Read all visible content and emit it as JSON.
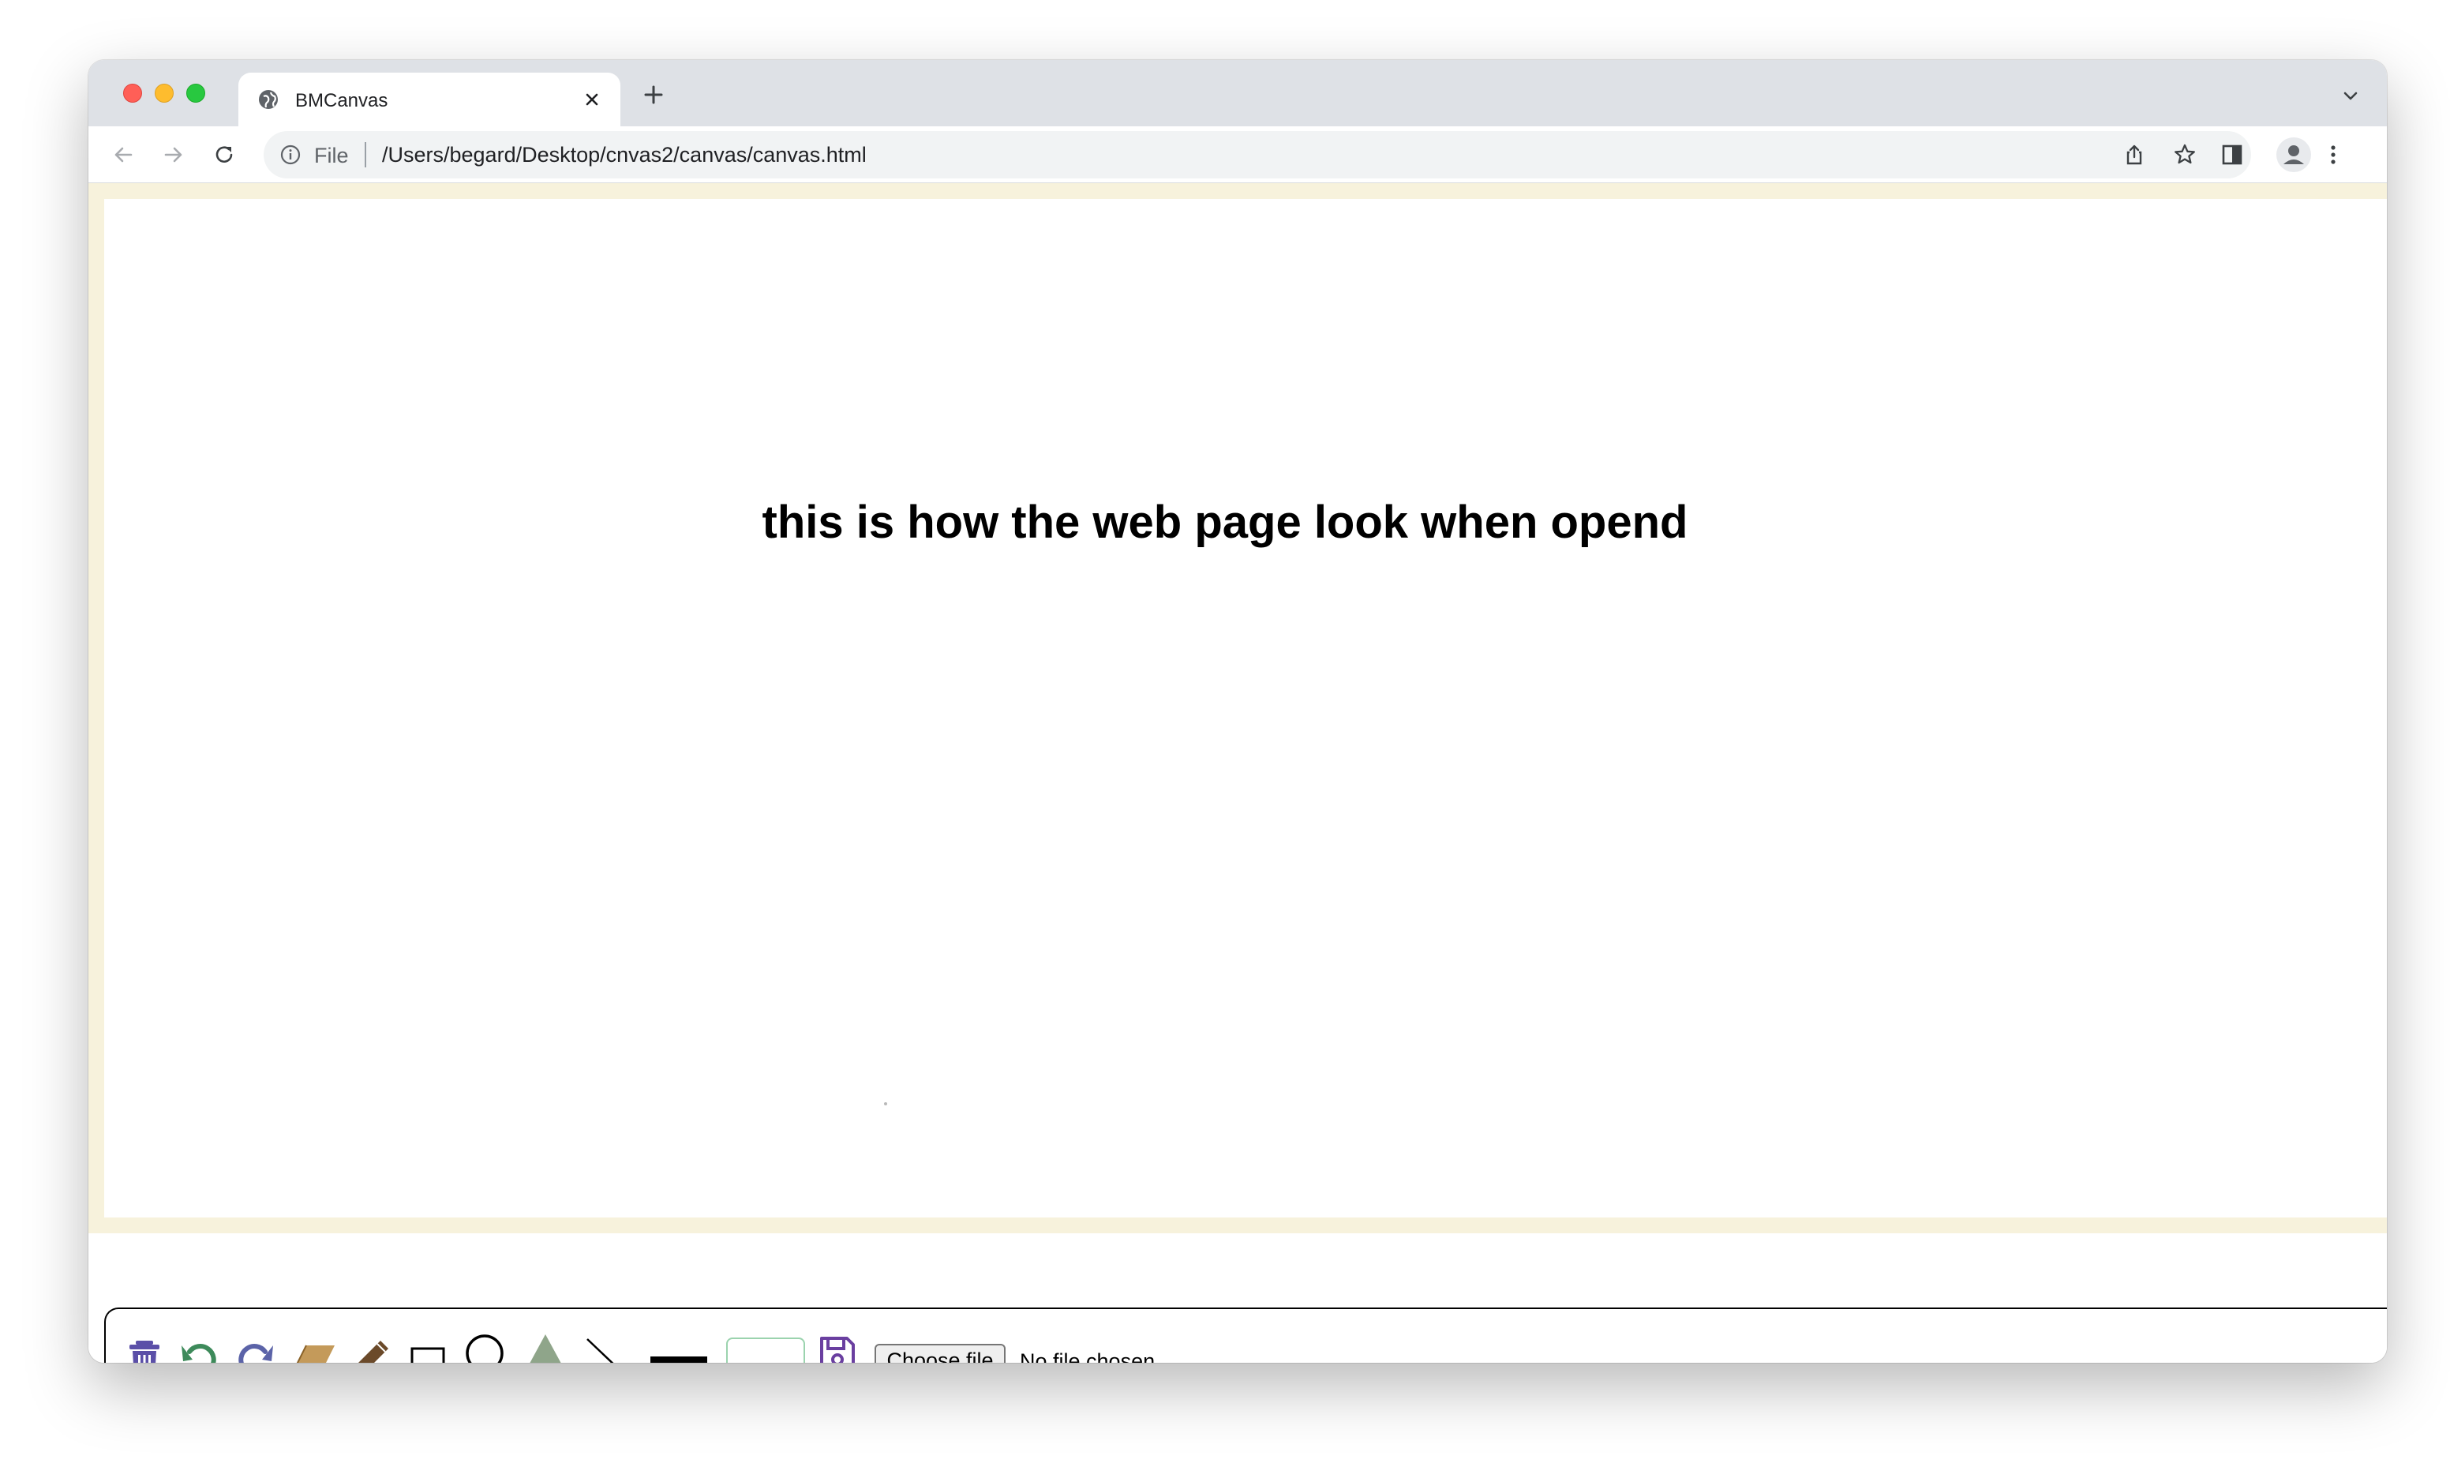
{
  "browser": {
    "tab_title": "BMCanvas",
    "url_scheme_label": "File",
    "url_path": "/Users/begard/Desktop/cnvas2/canvas/canvas.html"
  },
  "page": {
    "headline": "this is how the web page look when opend",
    "file_input": {
      "button_label": "Choose file",
      "status": "No file chosen"
    },
    "tools": [
      "trash-icon",
      "undo-icon",
      "redo-icon",
      "eraser-icon",
      "pencil-icon",
      "rectangle-icon",
      "circle-icon",
      "triangle-icon",
      "line-icon",
      "line-width-icon",
      "color-picker",
      "save-icon"
    ]
  },
  "colors": {
    "canvas_border": "#f7f2dc",
    "tool_purple": "#5b4fa8",
    "tool_green": "#3d8a5a",
    "eraser": "#c49a5a",
    "pencil": "#6b4a2a",
    "triangle": "#8fa58a"
  }
}
